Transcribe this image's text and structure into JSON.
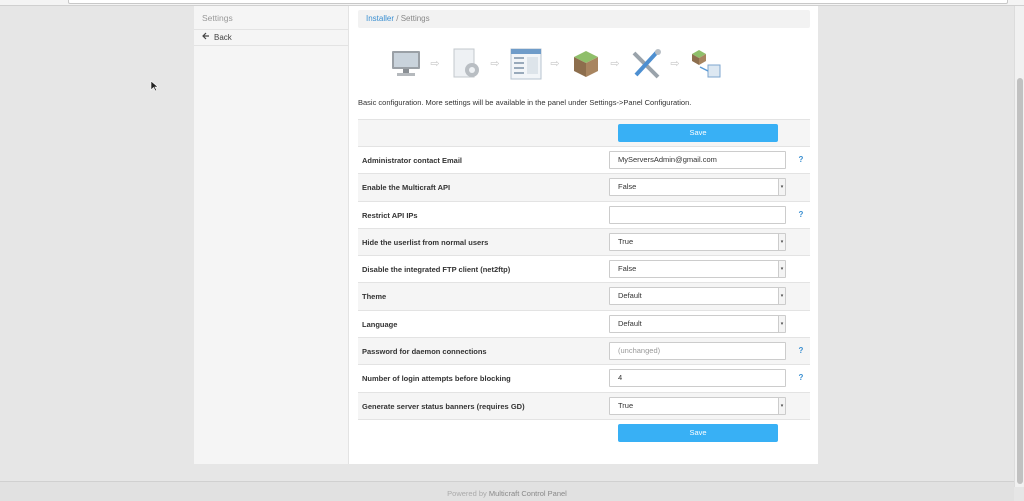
{
  "sidebar": {
    "title": "Settings",
    "back_label": "Back"
  },
  "breadcrumb": {
    "installer": "Installer",
    "separator": "/",
    "current": "Settings"
  },
  "wizard": {
    "steps": [
      "monitor-icon",
      "settings-doc-icon",
      "config-list-icon",
      "blocks-icon",
      "tools-icon",
      "network-blocks-icon"
    ]
  },
  "intro_text": "Basic configuration. More settings will be available in the panel under Settings->Panel Configuration.",
  "save_label": "Save",
  "fields": [
    {
      "label": "Administrator contact Email",
      "value": "MyServersAdmin@gmail.com",
      "type": "text",
      "help": "?"
    },
    {
      "label": "Enable the Multicraft API",
      "value": "False",
      "type": "select",
      "help": ""
    },
    {
      "label": "Restrict API IPs",
      "value": "",
      "type": "text",
      "help": "?"
    },
    {
      "label": "Hide the userlist from normal users",
      "value": "True",
      "type": "select",
      "help": ""
    },
    {
      "label": "Disable the integrated FTP client (net2ftp)",
      "value": "False",
      "type": "select",
      "help": ""
    },
    {
      "label": "Theme",
      "value": "Default",
      "type": "select",
      "help": ""
    },
    {
      "label": "Language",
      "value": "Default",
      "type": "select",
      "help": ""
    },
    {
      "label": "Password for daemon connections",
      "value": "",
      "placeholder": "(unchanged)",
      "type": "password",
      "help": "?"
    },
    {
      "label": "Number of login attempts before blocking",
      "value": "4",
      "type": "text",
      "help": "?"
    },
    {
      "label": "Generate server status banners (requires GD)",
      "value": "True",
      "type": "select",
      "help": ""
    }
  ],
  "footer": {
    "prefix": "Powered by",
    "link": "Multicraft Control Panel"
  },
  "colors": {
    "accent": "#38b0f5",
    "link": "#3a8fd1"
  }
}
